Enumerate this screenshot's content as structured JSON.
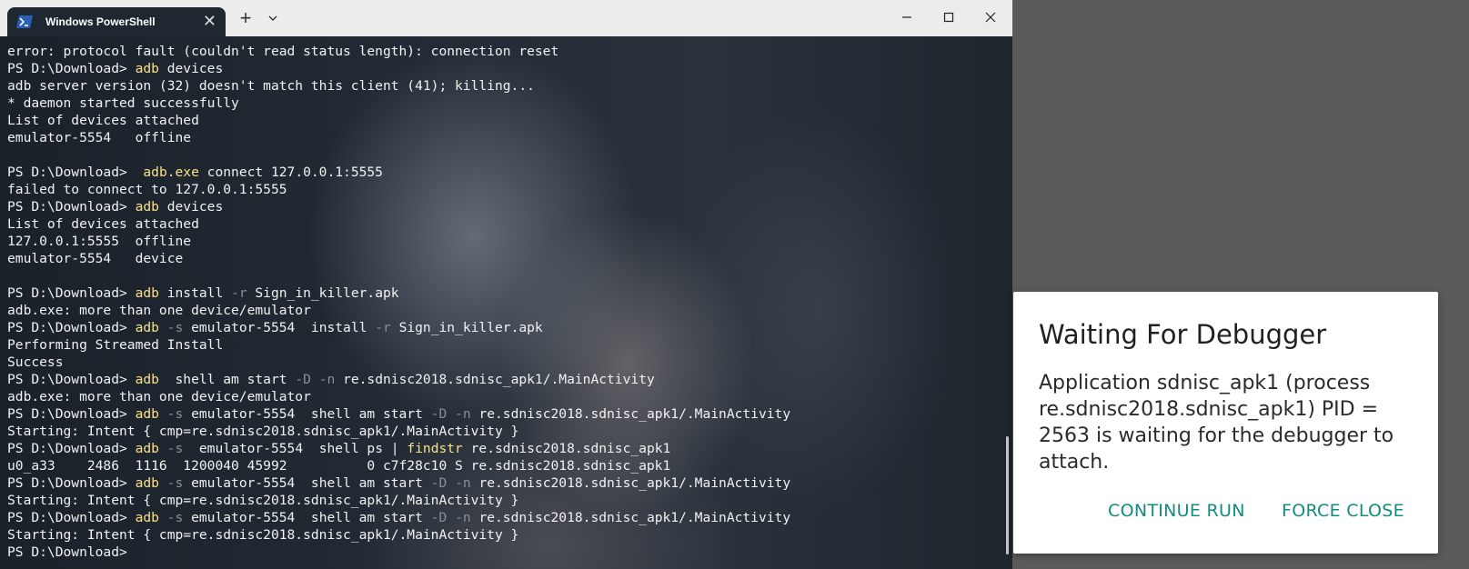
{
  "window": {
    "tab_title": "Windows PowerShell",
    "tab_close": "✕",
    "new_tab": "+",
    "dropdown": "⌄"
  },
  "terminal": {
    "lines": [
      [
        {
          "t": "error: protocol fault (couldn't read status length): connection reset",
          "c": "out"
        }
      ],
      [
        {
          "t": "PS D:\\Download> ",
          "c": "out"
        },
        {
          "t": "adb",
          "c": "cmd"
        },
        {
          "t": " devices",
          "c": "out"
        }
      ],
      [
        {
          "t": "adb server version (32) doesn't match this client (41); killing...",
          "c": "out"
        }
      ],
      [
        {
          "t": "* daemon started successfully",
          "c": "out"
        }
      ],
      [
        {
          "t": "List of devices attached",
          "c": "out"
        }
      ],
      [
        {
          "t": "emulator-5554   offline",
          "c": "out"
        }
      ],
      [
        {
          "t": "",
          "c": "out"
        }
      ],
      [
        {
          "t": "PS D:\\Download>  ",
          "c": "out"
        },
        {
          "t": "adb.exe",
          "c": "cmd"
        },
        {
          "t": " connect 127.0.0.1:5555",
          "c": "out"
        }
      ],
      [
        {
          "t": "failed to connect to 127.0.0.1:5555",
          "c": "out"
        }
      ],
      [
        {
          "t": "PS D:\\Download> ",
          "c": "out"
        },
        {
          "t": "adb",
          "c": "cmd"
        },
        {
          "t": " devices",
          "c": "out"
        }
      ],
      [
        {
          "t": "List of devices attached",
          "c": "out"
        }
      ],
      [
        {
          "t": "127.0.0.1:5555  offline",
          "c": "out"
        }
      ],
      [
        {
          "t": "emulator-5554   device",
          "c": "out"
        }
      ],
      [
        {
          "t": "",
          "c": "out"
        }
      ],
      [
        {
          "t": "PS D:\\Download> ",
          "c": "out"
        },
        {
          "t": "adb",
          "c": "cmd"
        },
        {
          "t": " install ",
          "c": "out"
        },
        {
          "t": "-r",
          "c": "flag"
        },
        {
          "t": " Sign_in_killer.apk",
          "c": "out"
        }
      ],
      [
        {
          "t": "adb.exe: more than one device/emulator",
          "c": "out"
        }
      ],
      [
        {
          "t": "PS D:\\Download> ",
          "c": "out"
        },
        {
          "t": "adb",
          "c": "cmd"
        },
        {
          "t": " ",
          "c": "out"
        },
        {
          "t": "-s",
          "c": "flag"
        },
        {
          "t": " emulator-5554  install ",
          "c": "out"
        },
        {
          "t": "-r",
          "c": "flag"
        },
        {
          "t": " Sign_in_killer.apk",
          "c": "out"
        }
      ],
      [
        {
          "t": "Performing Streamed Install",
          "c": "out"
        }
      ],
      [
        {
          "t": "Success",
          "c": "out"
        }
      ],
      [
        {
          "t": "PS D:\\Download> ",
          "c": "out"
        },
        {
          "t": "adb",
          "c": "cmd"
        },
        {
          "t": "  shell am start ",
          "c": "out"
        },
        {
          "t": "-D",
          "c": "flag"
        },
        {
          "t": " ",
          "c": "out"
        },
        {
          "t": "-n",
          "c": "flag"
        },
        {
          "t": " re.sdnisc2018.sdnisc_apk1/.MainActivity",
          "c": "out"
        }
      ],
      [
        {
          "t": "adb.exe: more than one device/emulator",
          "c": "out"
        }
      ],
      [
        {
          "t": "PS D:\\Download> ",
          "c": "out"
        },
        {
          "t": "adb",
          "c": "cmd"
        },
        {
          "t": " ",
          "c": "out"
        },
        {
          "t": "-s",
          "c": "flag"
        },
        {
          "t": " emulator-5554  shell am start ",
          "c": "out"
        },
        {
          "t": "-D",
          "c": "flag"
        },
        {
          "t": " ",
          "c": "out"
        },
        {
          "t": "-n",
          "c": "flag"
        },
        {
          "t": " re.sdnisc2018.sdnisc_apk1/.MainActivity",
          "c": "out"
        }
      ],
      [
        {
          "t": "Starting: Intent { cmp=re.sdnisc2018.sdnisc_apk1/.MainActivity }",
          "c": "out"
        }
      ],
      [
        {
          "t": "PS D:\\Download> ",
          "c": "out"
        },
        {
          "t": "adb",
          "c": "cmd"
        },
        {
          "t": " ",
          "c": "out"
        },
        {
          "t": "-s",
          "c": "flag"
        },
        {
          "t": "  emulator-5554  shell ps | ",
          "c": "out"
        },
        {
          "t": "findstr",
          "c": "cmd"
        },
        {
          "t": " re.sdnisc2018.sdnisc_apk1",
          "c": "out"
        }
      ],
      [
        {
          "t": "u0_a33    2486  1116  1200040 45992          0 c7f28c10 S re.sdnisc2018.sdnisc_apk1",
          "c": "out"
        }
      ],
      [
        {
          "t": "PS D:\\Download> ",
          "c": "out"
        },
        {
          "t": "adb",
          "c": "cmd"
        },
        {
          "t": " ",
          "c": "out"
        },
        {
          "t": "-s",
          "c": "flag"
        },
        {
          "t": " emulator-5554  shell am start ",
          "c": "out"
        },
        {
          "t": "-D",
          "c": "flag"
        },
        {
          "t": " ",
          "c": "out"
        },
        {
          "t": "-n",
          "c": "flag"
        },
        {
          "t": " re.sdnisc2018.sdnisc_apk1/.MainActivity",
          "c": "out"
        }
      ],
      [
        {
          "t": "Starting: Intent { cmp=re.sdnisc2018.sdnisc_apk1/.MainActivity }",
          "c": "out"
        }
      ],
      [
        {
          "t": "PS D:\\Download> ",
          "c": "out"
        },
        {
          "t": "adb",
          "c": "cmd"
        },
        {
          "t": " ",
          "c": "out"
        },
        {
          "t": "-s",
          "c": "flag"
        },
        {
          "t": " emulator-5554  shell am start ",
          "c": "out"
        },
        {
          "t": "-D",
          "c": "flag"
        },
        {
          "t": " ",
          "c": "out"
        },
        {
          "t": "-n",
          "c": "flag"
        },
        {
          "t": " re.sdnisc2018.sdnisc_apk1/.MainActivity",
          "c": "out"
        }
      ],
      [
        {
          "t": "Starting: Intent { cmp=re.sdnisc2018.sdnisc_apk1/.MainActivity }",
          "c": "out"
        }
      ],
      [
        {
          "t": "PS D:\\Download> ",
          "c": "out"
        }
      ]
    ],
    "colors": {
      "output": "#f2f2f2",
      "command": "#f9e08a",
      "flag": "#8a8f96",
      "background": "#1f2730"
    }
  },
  "dialog": {
    "title": "Waiting For Debugger",
    "message": "Application sdnisc_apk1 (process re.sdnisc2018.sdnisc_apk1) PID = 2563 is waiting for the debugger to attach.",
    "continue_label": "CONTINUE RUN",
    "force_close_label": "FORCE CLOSE",
    "accent_color": "#128c7e"
  }
}
